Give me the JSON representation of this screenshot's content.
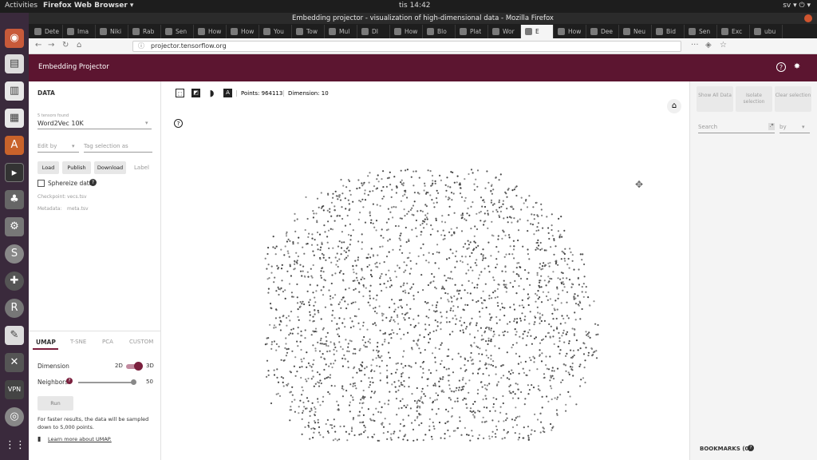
{
  "topbar": {
    "activities": "Activities",
    "app_menu": "Firefox Web Browser ▾",
    "clock": "tis 14:42",
    "tray": "sv ▾   ⏻ ▾"
  },
  "window": {
    "title": "Embedding projector - visualization of high-dimensional data - Mozilla Firefox"
  },
  "tabs": [
    "Dete",
    "Ima",
    "Niki",
    "Rab",
    "Sen",
    "How",
    "How",
    "You",
    "Tow",
    "Mul",
    "DI",
    "How",
    "Blo",
    "Plat",
    "Wor",
    "E",
    "How",
    "Dee",
    "Neu",
    "Bid",
    "Sen",
    "Exc",
    "ubu"
  ],
  "url": {
    "host": "projector.tensorflow.org"
  },
  "appbar": {
    "title": "Embedding Projector",
    "help_icon": "?",
    "bug_icon": "✸"
  },
  "left": {
    "section": "DATA",
    "tensors_found": "5 tensors found",
    "dataset": "Word2Vec 10K",
    "edit_by": "Edit by",
    "tag_placeholder": "Tag selection as",
    "load": "Load",
    "publish": "Publish",
    "download": "Download",
    "label": "Label",
    "spherize": "Sphereize data",
    "checkpoint": "Checkpoint:",
    "checkpoint_val": "vecs.tsv",
    "metadata": "Metadata:",
    "metadata_val": "meta.tsv",
    "projection_tabs": [
      "UMAP",
      "T-SNE",
      "PCA",
      "CUSTOM"
    ],
    "dimension": "Dimension",
    "dim_2d": "2D",
    "dim_3d": "3D",
    "neighbors": "Neighbors",
    "neighbors_val": "50",
    "run": "Run",
    "note": "For faster results, the data will be sampled down to 5,000 points.",
    "learn_more": "Learn more about UMAP."
  },
  "center": {
    "points": "Points: 964113",
    "dimension": "Dimension: 10"
  },
  "right": {
    "show_all": "Show All Data",
    "isolate": "Isolate selection",
    "clear": "Clear selection",
    "search": "Search",
    "by": "by",
    "bookmarks": "BOOKMARKS (0)"
  },
  "colors": {
    "appbar": "#5c1530",
    "toggle": "#7a1f3d"
  }
}
